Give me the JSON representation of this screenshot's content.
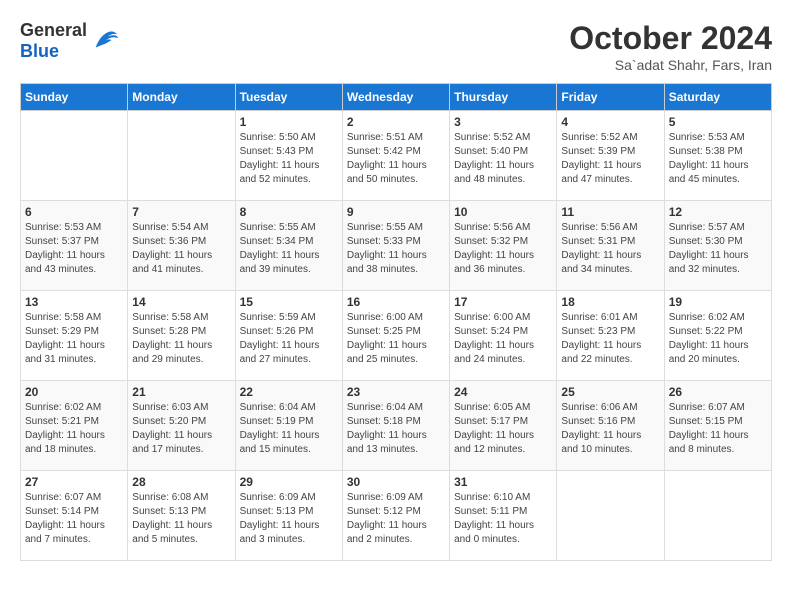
{
  "header": {
    "logo_general": "General",
    "logo_blue": "Blue",
    "month_title": "October 2024",
    "subtitle": "Sa`adat Shahr, Fars, Iran"
  },
  "weekdays": [
    "Sunday",
    "Monday",
    "Tuesday",
    "Wednesday",
    "Thursday",
    "Friday",
    "Saturday"
  ],
  "weeks": [
    [
      {
        "day": "",
        "info": ""
      },
      {
        "day": "",
        "info": ""
      },
      {
        "day": "1",
        "info": "Sunrise: 5:50 AM\nSunset: 5:43 PM\nDaylight: 11 hours and 52 minutes."
      },
      {
        "day": "2",
        "info": "Sunrise: 5:51 AM\nSunset: 5:42 PM\nDaylight: 11 hours and 50 minutes."
      },
      {
        "day": "3",
        "info": "Sunrise: 5:52 AM\nSunset: 5:40 PM\nDaylight: 11 hours and 48 minutes."
      },
      {
        "day": "4",
        "info": "Sunrise: 5:52 AM\nSunset: 5:39 PM\nDaylight: 11 hours and 47 minutes."
      },
      {
        "day": "5",
        "info": "Sunrise: 5:53 AM\nSunset: 5:38 PM\nDaylight: 11 hours and 45 minutes."
      }
    ],
    [
      {
        "day": "6",
        "info": "Sunrise: 5:53 AM\nSunset: 5:37 PM\nDaylight: 11 hours and 43 minutes."
      },
      {
        "day": "7",
        "info": "Sunrise: 5:54 AM\nSunset: 5:36 PM\nDaylight: 11 hours and 41 minutes."
      },
      {
        "day": "8",
        "info": "Sunrise: 5:55 AM\nSunset: 5:34 PM\nDaylight: 11 hours and 39 minutes."
      },
      {
        "day": "9",
        "info": "Sunrise: 5:55 AM\nSunset: 5:33 PM\nDaylight: 11 hours and 38 minutes."
      },
      {
        "day": "10",
        "info": "Sunrise: 5:56 AM\nSunset: 5:32 PM\nDaylight: 11 hours and 36 minutes."
      },
      {
        "day": "11",
        "info": "Sunrise: 5:56 AM\nSunset: 5:31 PM\nDaylight: 11 hours and 34 minutes."
      },
      {
        "day": "12",
        "info": "Sunrise: 5:57 AM\nSunset: 5:30 PM\nDaylight: 11 hours and 32 minutes."
      }
    ],
    [
      {
        "day": "13",
        "info": "Sunrise: 5:58 AM\nSunset: 5:29 PM\nDaylight: 11 hours and 31 minutes."
      },
      {
        "day": "14",
        "info": "Sunrise: 5:58 AM\nSunset: 5:28 PM\nDaylight: 11 hours and 29 minutes."
      },
      {
        "day": "15",
        "info": "Sunrise: 5:59 AM\nSunset: 5:26 PM\nDaylight: 11 hours and 27 minutes."
      },
      {
        "day": "16",
        "info": "Sunrise: 6:00 AM\nSunset: 5:25 PM\nDaylight: 11 hours and 25 minutes."
      },
      {
        "day": "17",
        "info": "Sunrise: 6:00 AM\nSunset: 5:24 PM\nDaylight: 11 hours and 24 minutes."
      },
      {
        "day": "18",
        "info": "Sunrise: 6:01 AM\nSunset: 5:23 PM\nDaylight: 11 hours and 22 minutes."
      },
      {
        "day": "19",
        "info": "Sunrise: 6:02 AM\nSunset: 5:22 PM\nDaylight: 11 hours and 20 minutes."
      }
    ],
    [
      {
        "day": "20",
        "info": "Sunrise: 6:02 AM\nSunset: 5:21 PM\nDaylight: 11 hours and 18 minutes."
      },
      {
        "day": "21",
        "info": "Sunrise: 6:03 AM\nSunset: 5:20 PM\nDaylight: 11 hours and 17 minutes."
      },
      {
        "day": "22",
        "info": "Sunrise: 6:04 AM\nSunset: 5:19 PM\nDaylight: 11 hours and 15 minutes."
      },
      {
        "day": "23",
        "info": "Sunrise: 6:04 AM\nSunset: 5:18 PM\nDaylight: 11 hours and 13 minutes."
      },
      {
        "day": "24",
        "info": "Sunrise: 6:05 AM\nSunset: 5:17 PM\nDaylight: 11 hours and 12 minutes."
      },
      {
        "day": "25",
        "info": "Sunrise: 6:06 AM\nSunset: 5:16 PM\nDaylight: 11 hours and 10 minutes."
      },
      {
        "day": "26",
        "info": "Sunrise: 6:07 AM\nSunset: 5:15 PM\nDaylight: 11 hours and 8 minutes."
      }
    ],
    [
      {
        "day": "27",
        "info": "Sunrise: 6:07 AM\nSunset: 5:14 PM\nDaylight: 11 hours and 7 minutes."
      },
      {
        "day": "28",
        "info": "Sunrise: 6:08 AM\nSunset: 5:13 PM\nDaylight: 11 hours and 5 minutes."
      },
      {
        "day": "29",
        "info": "Sunrise: 6:09 AM\nSunset: 5:13 PM\nDaylight: 11 hours and 3 minutes."
      },
      {
        "day": "30",
        "info": "Sunrise: 6:09 AM\nSunset: 5:12 PM\nDaylight: 11 hours and 2 minutes."
      },
      {
        "day": "31",
        "info": "Sunrise: 6:10 AM\nSunset: 5:11 PM\nDaylight: 11 hours and 0 minutes."
      },
      {
        "day": "",
        "info": ""
      },
      {
        "day": "",
        "info": ""
      }
    ]
  ]
}
